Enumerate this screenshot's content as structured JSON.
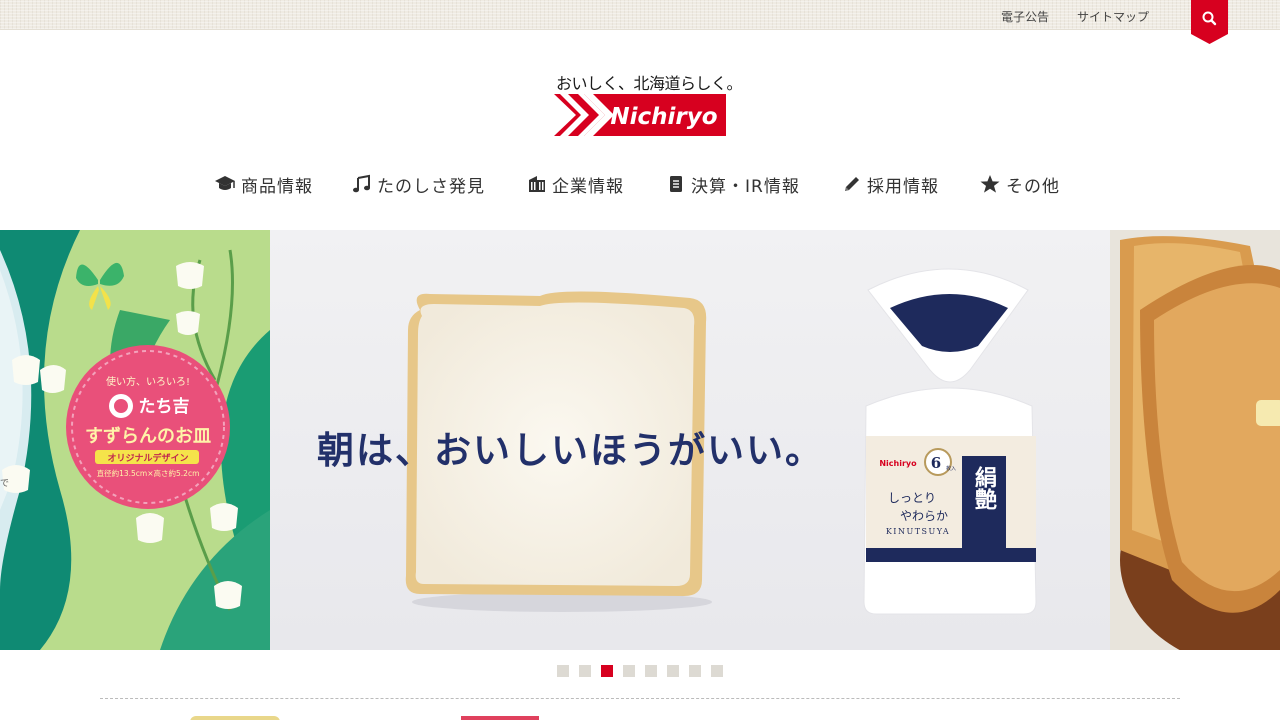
{
  "topbar": {
    "links": [
      "電子公告",
      "サイトマップ"
    ]
  },
  "logo": {
    "tagline": "おいしく、北海道らしく。",
    "brand": "Nichiryo",
    "brand_color": "#d7001f"
  },
  "nav": {
    "items": [
      {
        "label": "商品情報",
        "icon": "graduation-cap-icon"
      },
      {
        "label": "たのしさ発見",
        "icon": "music-note-icon"
      },
      {
        "label": "企業情報",
        "icon": "building-icon"
      },
      {
        "label": "決算・IR情報",
        "icon": "document-icon"
      },
      {
        "label": "採用情報",
        "icon": "pencil-icon"
      },
      {
        "label": "その他",
        "icon": "star-icon"
      }
    ]
  },
  "slides": {
    "left": {
      "badge_top": "使い方、いろいろ!",
      "badge_brand": "たち吉",
      "badge_title": "すずらんのお皿",
      "badge_ribbon": "オリジナルデザイン",
      "badge_spec": "直径約13.5cm×高さ約5.2cm",
      "edge_text": "で"
    },
    "main": {
      "copy": "朝は、おいしいほうがいい。",
      "package": {
        "brand": "Nichiryo",
        "count": "6",
        "count_unit": "枚入",
        "tagline1": "しっとり",
        "tagline2": "やわらか",
        "name_kanji": "絹艶",
        "name_roman": "KINUTSUYA"
      }
    }
  },
  "carousel": {
    "dot_count": 8,
    "active_index": 2
  },
  "colors": {
    "accent": "#d7001f",
    "copy": "#22306a",
    "package_navy": "#1e2a5c"
  }
}
